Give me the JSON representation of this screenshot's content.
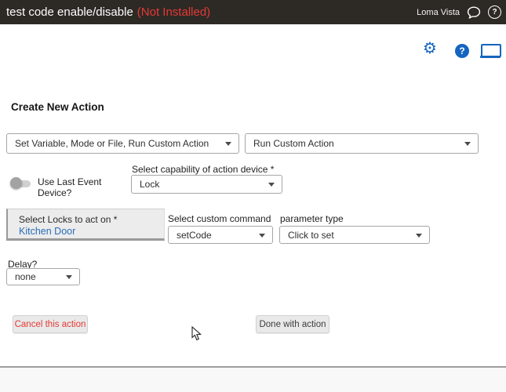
{
  "topbar": {
    "title": "test code enable/disable",
    "status": "(Not Installed)",
    "location": "Loma Vista"
  },
  "icons": {
    "gear_glyph": "⚙",
    "help_glyph": "?"
  },
  "form": {
    "heading": "Create New Action",
    "action_type": "Set Variable, Mode or File, Run Custom Action",
    "action_kind": "Run Custom Action",
    "use_last_event_label": "Use Last Event Device?",
    "use_last_event_state": "off",
    "capability_label": "Select capability of action device *",
    "capability_value": "Lock",
    "devices_label": "Select Locks to act on *",
    "devices_selected": "Kitchen Door",
    "command_label": "Select custom command",
    "command_value": "setCode",
    "parameter_label": "parameter type",
    "parameter_value": "Click to set",
    "delay_label": "Delay?",
    "delay_value": "none"
  },
  "buttons": {
    "cancel": "Cancel this action",
    "done": "Done with action"
  },
  "colors": {
    "topbar_bg": "#2d2a26",
    "accent_blue": "#1565c0",
    "alert_red": "#e53935",
    "link_blue": "#2a6db5"
  }
}
